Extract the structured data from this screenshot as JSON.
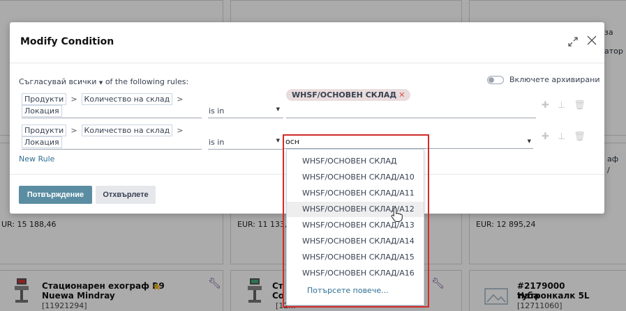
{
  "background": {
    "texts": [
      {
        "id": "top-right-za",
        "text": "за"
      },
      {
        "id": "top-right-ator",
        "text": "атор"
      },
      {
        "id": "right-af",
        "text": "аф"
      },
      {
        "id": "right-slash",
        "text": "/"
      }
    ],
    "prices": [
      "UR: 15 188,46",
      "EUR: 11 133,7",
      "EUR: 12 895,24"
    ],
    "cards": [
      {
        "title_line1": "Стационарен ехограф R9",
        "title_line2": "Nuewa Mindray",
        "code": "[11921294]"
      },
      {
        "title_line1": "Ст",
        "title_line2": "Со",
        "code": "[12..."
      },
      {
        "title_line1": "#2179000 Натронкалк 5L",
        "title_line2": "туба",
        "code": "[12711060]"
      }
    ]
  },
  "modal": {
    "title": "Modify Condition",
    "match_prefix": "Съгласувай",
    "match_mode": "всички",
    "match_suffix": "of the following rules:",
    "archive_label": "Включете архивирани",
    "rules": [
      {
        "path": [
          "Продукти",
          "Количество на склад",
          "Локация"
        ],
        "operator": "is in",
        "value_chip": "WHSF/ОСНОВЕН СКЛАД"
      },
      {
        "path": [
          "Продукти",
          "Количество на склад",
          "Локация"
        ],
        "operator": "is in",
        "search": "осн"
      }
    ],
    "new_rule": "New Rule",
    "confirm_button": "Потвърждение",
    "discard_button": "Отхвърлете"
  },
  "dropdown": {
    "options": [
      "WHSF/ОСНОВЕН СКЛАД",
      "WHSF/ОСНОВЕН СКЛАД/A10",
      "WHSF/ОСНОВЕН СКЛАД/A11",
      "WHSF/ОСНОВЕН СКЛАД/A12",
      "WHSF/ОСНОВЕН СКЛАД/A13",
      "WHSF/ОСНОВЕН СКЛАД/A14",
      "WHSF/ОСНОВЕН СКЛАД/A15",
      "WHSF/ОСНОВЕН СКЛАД/A16"
    ],
    "hovered_option": "WHSF/ОСНОВЕН СКЛАД/A12",
    "search_more": "Потърсете повече..."
  },
  "colors": {
    "primary": "#5a8da2",
    "link": "#2f6f94",
    "chip_bg": "#e9dcdc",
    "chip_x": "#d9534f",
    "highlight": "#d22b2b",
    "wrench": "#6f4a8e",
    "star": "#f3b60d"
  },
  "icons": [
    "expand-icon",
    "close-icon",
    "add-icon",
    "hierarchy-icon",
    "trash-icon",
    "wrench-icon",
    "star-icon",
    "pointer-cursor-icon",
    "toggle-switch"
  ]
}
